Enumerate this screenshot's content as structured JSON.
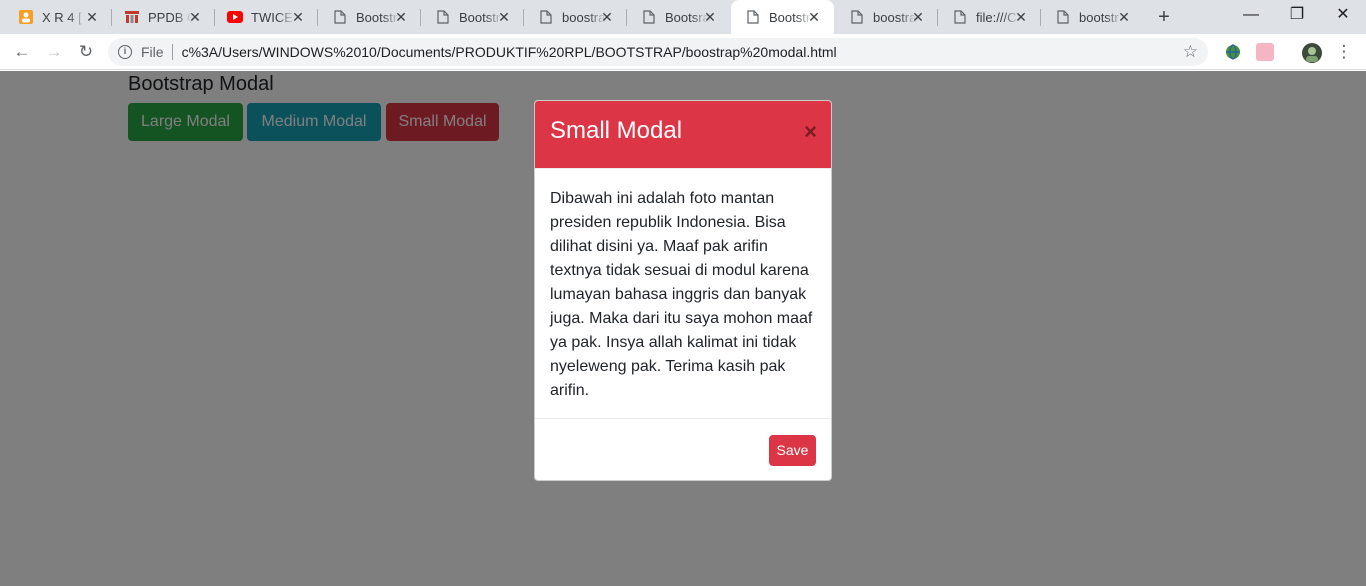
{
  "browser": {
    "tabs": [
      {
        "title": "X R 4 [",
        "icon": "orange-person-icon"
      },
      {
        "title": "PPDB C",
        "icon": "school-logo-icon"
      },
      {
        "title": "TWICE",
        "icon": "youtube-icon"
      },
      {
        "title": "Bootstr",
        "icon": "page-icon"
      },
      {
        "title": "Bootstr",
        "icon": "page-icon"
      },
      {
        "title": "boostra",
        "icon": "page-icon"
      },
      {
        "title": "Bootsra",
        "icon": "page-icon"
      },
      {
        "title": "Bootstr",
        "icon": "page-icon",
        "active": true
      },
      {
        "title": "boostra",
        "icon": "page-icon"
      },
      {
        "title": "file:///C",
        "icon": "page-icon"
      },
      {
        "title": "bootstr",
        "icon": "page-icon"
      }
    ],
    "address": {
      "scheme_label": "File",
      "url": "c%3A/Users/WINDOWS%2010/Documents/PRODUKTIF%20RPL/BOOTSTRAP/boostrap%20modal.html"
    }
  },
  "page": {
    "heading": "Bootstrap Modal",
    "buttons": [
      {
        "label": "Large Modal",
        "color": "#28a745"
      },
      {
        "label": "Medium Modal",
        "color": "#17a2b8"
      },
      {
        "label": "Small Modal",
        "color": "#dc3545"
      }
    ]
  },
  "modal": {
    "title": "Small Modal",
    "close_label": "×",
    "body": "Dibawah ini adalah foto mantan presiden republik Indonesia. Bisa dilihat disini ya. Maaf pak arifin textnya tidak sesuai di modul karena lumayan bahasa inggris dan banyak juga. Maka dari itu saya mohon maaf ya pak. Insya allah kalimat ini tidak nyeleweng pak. Terima kasih pak arifin.",
    "save_label": "Save",
    "header_color": "#dc3545"
  }
}
